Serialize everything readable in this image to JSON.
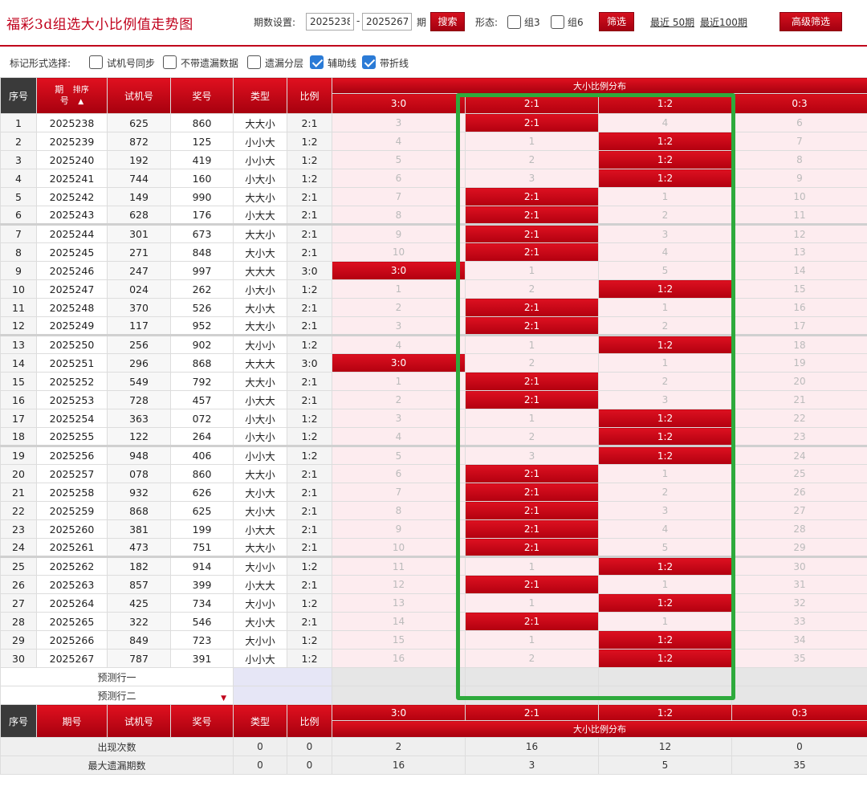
{
  "header": {
    "title": "福彩3d组选大小比例值走势图",
    "period_label": "期数设置:",
    "period_from": "2025238",
    "period_sep": "-",
    "period_to": "2025267",
    "period_unit": "期",
    "search_label": "搜索",
    "shape_label": "形态:",
    "group3_label": "组3",
    "group6_label": "组6",
    "filter_label": "筛选",
    "recent50_label": "最近 50期",
    "recent100_label": "最近100期",
    "advanced_label": "高级筛选"
  },
  "marks": {
    "label": "标记形式选择:",
    "options": [
      {
        "label": "试机号同步",
        "checked": false
      },
      {
        "label": "不带遗漏数据",
        "checked": false
      },
      {
        "label": "遗漏分层",
        "checked": false
      },
      {
        "label": "辅助线",
        "checked": true
      },
      {
        "label": "带折线",
        "checked": true
      }
    ]
  },
  "table": {
    "headers": {
      "seq": "序号",
      "period_top": "期",
      "period_sort": "排序",
      "period_bottom": "号",
      "test": "试机号",
      "prize": "奖号",
      "type": "类型",
      "ratio": "比例",
      "dist_title": "大小比例分布",
      "dist_cols": [
        "3:0",
        "2:1",
        "1:2",
        "0:3"
      ]
    },
    "footer_headers": {
      "seq": "序号",
      "period": "期号",
      "test": "试机号",
      "prize": "奖号",
      "type": "类型",
      "ratio": "比例",
      "dist_cols": [
        "3:0",
        "2:1",
        "1:2",
        "0:3"
      ],
      "dist_title": "大小比例分布"
    },
    "rows": [
      {
        "seq": "1",
        "period": "2025238",
        "test": "625",
        "prize": "860",
        "type": "大大小",
        "ratio": "2:1",
        "dist": [
          "3",
          "2:1",
          "4",
          "6"
        ],
        "hit": 1
      },
      {
        "seq": "2",
        "period": "2025239",
        "test": "872",
        "prize": "125",
        "type": "小小大",
        "ratio": "1:2",
        "dist": [
          "4",
          "1",
          "1:2",
          "7"
        ],
        "hit": 2
      },
      {
        "seq": "3",
        "period": "2025240",
        "test": "192",
        "prize": "419",
        "type": "小小大",
        "ratio": "1:2",
        "dist": [
          "5",
          "2",
          "1:2",
          "8"
        ],
        "hit": 2
      },
      {
        "seq": "4",
        "period": "2025241",
        "test": "744",
        "prize": "160",
        "type": "小大小",
        "ratio": "1:2",
        "dist": [
          "6",
          "3",
          "1:2",
          "9"
        ],
        "hit": 2
      },
      {
        "seq": "5",
        "period": "2025242",
        "test": "149",
        "prize": "990",
        "type": "大大小",
        "ratio": "2:1",
        "dist": [
          "7",
          "2:1",
          "1",
          "10"
        ],
        "hit": 1
      },
      {
        "seq": "6",
        "period": "2025243",
        "test": "628",
        "prize": "176",
        "type": "小大大",
        "ratio": "2:1",
        "dist": [
          "8",
          "2:1",
          "2",
          "11"
        ],
        "hit": 1
      },
      {
        "seq": "7",
        "period": "2025244",
        "test": "301",
        "prize": "673",
        "type": "大大小",
        "ratio": "2:1",
        "dist": [
          "9",
          "2:1",
          "3",
          "12"
        ],
        "hit": 1
      },
      {
        "seq": "8",
        "period": "2025245",
        "test": "271",
        "prize": "848",
        "type": "大小大",
        "ratio": "2:1",
        "dist": [
          "10",
          "2:1",
          "4",
          "13"
        ],
        "hit": 1
      },
      {
        "seq": "9",
        "period": "2025246",
        "test": "247",
        "prize": "997",
        "type": "大大大",
        "ratio": "3:0",
        "dist": [
          "3:0",
          "1",
          "5",
          "14"
        ],
        "hit": 0
      },
      {
        "seq": "10",
        "period": "2025247",
        "test": "024",
        "prize": "262",
        "type": "小大小",
        "ratio": "1:2",
        "dist": [
          "1",
          "2",
          "1:2",
          "15"
        ],
        "hit": 2
      },
      {
        "seq": "11",
        "period": "2025248",
        "test": "370",
        "prize": "526",
        "type": "大小大",
        "ratio": "2:1",
        "dist": [
          "2",
          "2:1",
          "1",
          "16"
        ],
        "hit": 1
      },
      {
        "seq": "12",
        "period": "2025249",
        "test": "117",
        "prize": "952",
        "type": "大大小",
        "ratio": "2:1",
        "dist": [
          "3",
          "2:1",
          "2",
          "17"
        ],
        "hit": 1
      },
      {
        "seq": "13",
        "period": "2025250",
        "test": "256",
        "prize": "902",
        "type": "大小小",
        "ratio": "1:2",
        "dist": [
          "4",
          "1",
          "1:2",
          "18"
        ],
        "hit": 2
      },
      {
        "seq": "14",
        "period": "2025251",
        "test": "296",
        "prize": "868",
        "type": "大大大",
        "ratio": "3:0",
        "dist": [
          "3:0",
          "2",
          "1",
          "19"
        ],
        "hit": 0
      },
      {
        "seq": "15",
        "period": "2025252",
        "test": "549",
        "prize": "792",
        "type": "大大小",
        "ratio": "2:1",
        "dist": [
          "1",
          "2:1",
          "2",
          "20"
        ],
        "hit": 1
      },
      {
        "seq": "16",
        "period": "2025253",
        "test": "728",
        "prize": "457",
        "type": "小大大",
        "ratio": "2:1",
        "dist": [
          "2",
          "2:1",
          "3",
          "21"
        ],
        "hit": 1
      },
      {
        "seq": "17",
        "period": "2025254",
        "test": "363",
        "prize": "072",
        "type": "小大小",
        "ratio": "1:2",
        "dist": [
          "3",
          "1",
          "1:2",
          "22"
        ],
        "hit": 2
      },
      {
        "seq": "18",
        "period": "2025255",
        "test": "122",
        "prize": "264",
        "type": "小大小",
        "ratio": "1:2",
        "dist": [
          "4",
          "2",
          "1:2",
          "23"
        ],
        "hit": 2
      },
      {
        "seq": "19",
        "period": "2025256",
        "test": "948",
        "prize": "406",
        "type": "小小大",
        "ratio": "1:2",
        "dist": [
          "5",
          "3",
          "1:2",
          "24"
        ],
        "hit": 2
      },
      {
        "seq": "20",
        "period": "2025257",
        "test": "078",
        "prize": "860",
        "type": "大大小",
        "ratio": "2:1",
        "dist": [
          "6",
          "2:1",
          "1",
          "25"
        ],
        "hit": 1
      },
      {
        "seq": "21",
        "period": "2025258",
        "test": "932",
        "prize": "626",
        "type": "大小大",
        "ratio": "2:1",
        "dist": [
          "7",
          "2:1",
          "2",
          "26"
        ],
        "hit": 1
      },
      {
        "seq": "22",
        "period": "2025259",
        "test": "868",
        "prize": "625",
        "type": "大小大",
        "ratio": "2:1",
        "dist": [
          "8",
          "2:1",
          "3",
          "27"
        ],
        "hit": 1
      },
      {
        "seq": "23",
        "period": "2025260",
        "test": "381",
        "prize": "199",
        "type": "小大大",
        "ratio": "2:1",
        "dist": [
          "9",
          "2:1",
          "4",
          "28"
        ],
        "hit": 1
      },
      {
        "seq": "24",
        "period": "2025261",
        "test": "473",
        "prize": "751",
        "type": "大大小",
        "ratio": "2:1",
        "dist": [
          "10",
          "2:1",
          "5",
          "29"
        ],
        "hit": 1
      },
      {
        "seq": "25",
        "period": "2025262",
        "test": "182",
        "prize": "914",
        "type": "大小小",
        "ratio": "1:2",
        "dist": [
          "11",
          "1",
          "1:2",
          "30"
        ],
        "hit": 2
      },
      {
        "seq": "26",
        "period": "2025263",
        "test": "857",
        "prize": "399",
        "type": "小大大",
        "ratio": "2:1",
        "dist": [
          "12",
          "2:1",
          "1",
          "31"
        ],
        "hit": 1
      },
      {
        "seq": "27",
        "period": "2025264",
        "test": "425",
        "prize": "734",
        "type": "大小小",
        "ratio": "1:2",
        "dist": [
          "13",
          "1",
          "1:2",
          "32"
        ],
        "hit": 2
      },
      {
        "seq": "28",
        "period": "2025265",
        "test": "322",
        "prize": "546",
        "type": "大小大",
        "ratio": "2:1",
        "dist": [
          "14",
          "2:1",
          "1",
          "33"
        ],
        "hit": 1
      },
      {
        "seq": "29",
        "period": "2025266",
        "test": "849",
        "prize": "723",
        "type": "大小小",
        "ratio": "1:2",
        "dist": [
          "15",
          "1",
          "1:2",
          "34"
        ],
        "hit": 2
      },
      {
        "seq": "30",
        "period": "2025267",
        "test": "787",
        "prize": "391",
        "type": "小小大",
        "ratio": "1:2",
        "dist": [
          "16",
          "2",
          "1:2",
          "35"
        ],
        "hit": 2
      }
    ],
    "predict": [
      "预测行一",
      "预测行二"
    ],
    "stats": [
      {
        "label": "出现次数",
        "type": "0",
        "ratio": "0",
        "dist": [
          "2",
          "16",
          "12",
          "0"
        ]
      },
      {
        "label": "最大遗漏期数",
        "type": "0",
        "ratio": "0",
        "dist": [
          "16",
          "3",
          "5",
          "35"
        ]
      }
    ]
  },
  "colors": {
    "accent": "#c0001b",
    "highlight": "#2eaa3c",
    "check": "#2b7bd6"
  }
}
